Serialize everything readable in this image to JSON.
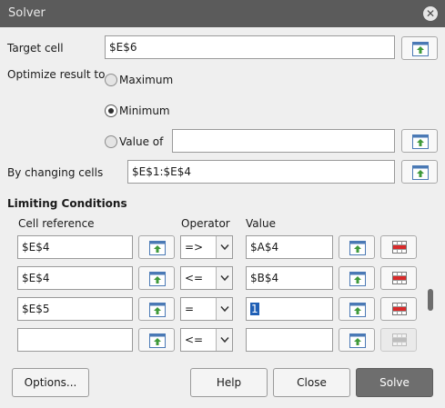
{
  "window": {
    "title": "Solver"
  },
  "target": {
    "label": "Target cell",
    "value": "$E$6"
  },
  "optimize": {
    "label": "Optimize result to",
    "options": [
      {
        "label": "Maximum",
        "selected": false
      },
      {
        "label": "Minimum",
        "selected": true
      },
      {
        "label": "Value of",
        "selected": false
      }
    ],
    "value_of": ""
  },
  "changing": {
    "label": "By changing cells",
    "value": "$E$1:$E$4"
  },
  "limits": {
    "heading": "Limiting Conditions",
    "headers": {
      "cell": "Cell reference",
      "operator": "Operator",
      "value": "Value"
    },
    "rows": [
      {
        "cell": "$E$4",
        "operator": "=>",
        "value": "$A$4",
        "delete_enabled": true
      },
      {
        "cell": "$E$4",
        "operator": "<=",
        "value": "$B$4",
        "delete_enabled": true
      },
      {
        "cell": "$E$5",
        "operator": "=",
        "value": "1",
        "delete_enabled": true
      },
      {
        "cell": "",
        "operator": "<=",
        "value": "",
        "delete_enabled": false
      }
    ]
  },
  "buttons": {
    "options": "Options...",
    "help": "Help",
    "close": "Close",
    "solve": "Solve"
  },
  "icons": {
    "shrink": "shrink-range-icon",
    "delete": "delete-row-icon",
    "close": "close-icon",
    "dropdown": "chevron-down-icon"
  }
}
